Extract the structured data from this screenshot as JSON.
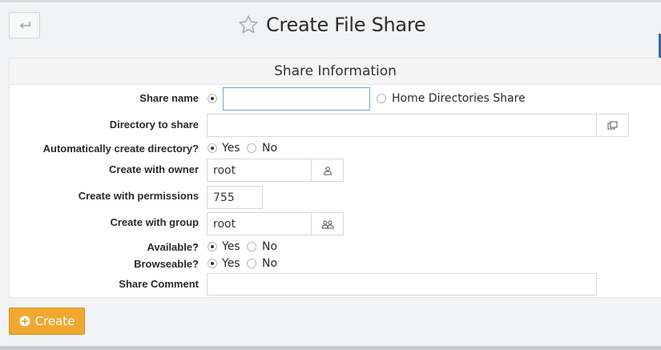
{
  "header": {
    "title": "Create File Share",
    "back_icon": "back-arrow-icon",
    "favorite_icon": "star-outline-icon"
  },
  "panel": {
    "title": "Share Information"
  },
  "form": {
    "share_name": {
      "label": "Share name",
      "value": "",
      "alt_option": "Home Directories Share",
      "selected": "name"
    },
    "directory": {
      "label": "Directory to share",
      "value": "",
      "button_icon": "file-chooser-icon"
    },
    "auto_create": {
      "label": "Automatically create directory?",
      "yes": "Yes",
      "no": "No",
      "selected": "yes"
    },
    "owner": {
      "label": "Create with owner",
      "value": "root",
      "button_icon": "user-icon"
    },
    "permissions": {
      "label": "Create with permissions",
      "value": "755"
    },
    "group": {
      "label": "Create with group",
      "value": "root",
      "button_icon": "group-icon"
    },
    "available": {
      "label": "Available?",
      "yes": "Yes",
      "no": "No",
      "selected": "yes"
    },
    "browseable": {
      "label": "Browseable?",
      "yes": "Yes",
      "no": "No",
      "selected": "yes"
    },
    "comment": {
      "label": "Share Comment",
      "value": ""
    }
  },
  "actions": {
    "create_label": "Create"
  },
  "colors": {
    "accent": "#f0a830",
    "focus_border": "#6fa6cf",
    "right_marker": "#2e6da4"
  }
}
